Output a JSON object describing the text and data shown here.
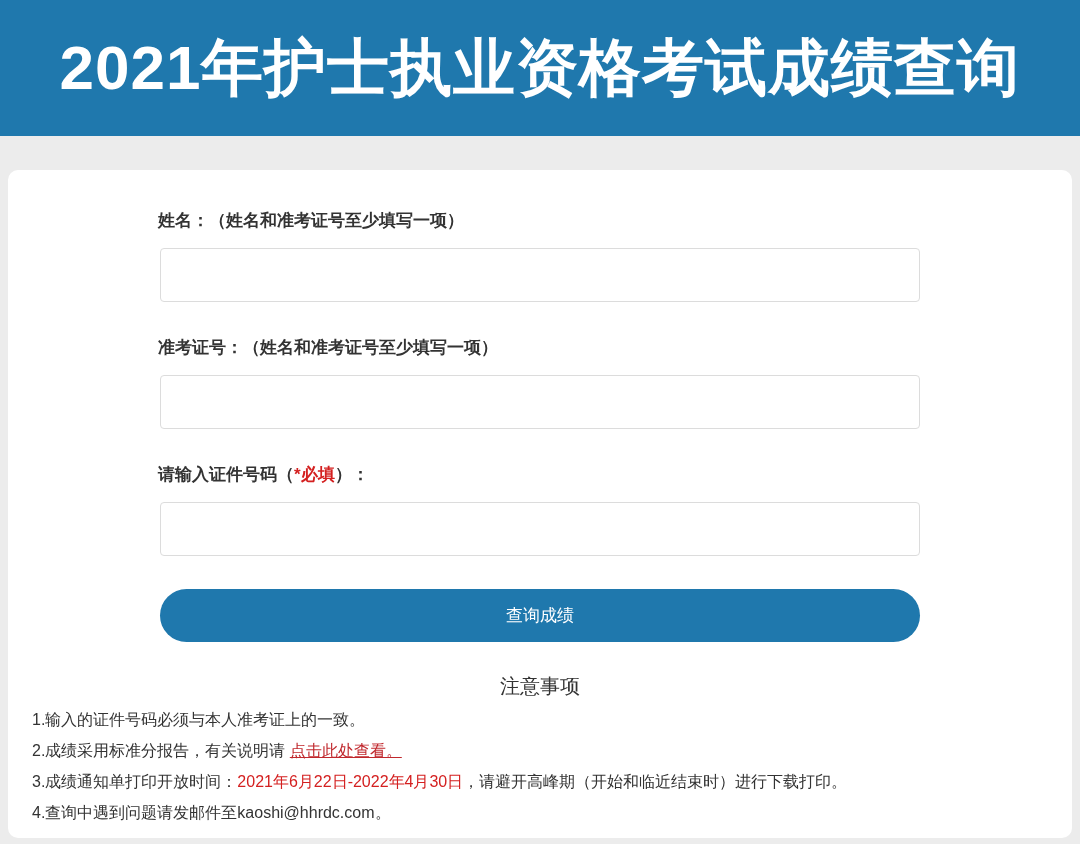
{
  "header": {
    "title": "2021年护士执业资格考试成绩查询"
  },
  "form": {
    "fields": [
      {
        "label": [
          {
            "kind": "text",
            "text": "姓名：（姓名和准考证号至少填写一项）"
          }
        ]
      },
      {
        "label": [
          {
            "kind": "text",
            "text": "准考证号：（姓名和准考证号至少填写一项）"
          }
        ]
      },
      {
        "label": [
          {
            "kind": "text",
            "text": "请输入证件号码（"
          },
          {
            "kind": "required",
            "text": "*必填"
          },
          {
            "kind": "text",
            "text": "）："
          }
        ]
      }
    ],
    "submit": "查询成绩"
  },
  "notes": {
    "title": "注意事项",
    "items": [
      [
        {
          "kind": "text",
          "text": "1.输入的证件号码必须与本人准考证上的一致。"
        }
      ],
      [
        {
          "kind": "text",
          "text": "2.成绩采用标准分报告，有关说明请 "
        },
        {
          "kind": "link",
          "text": "点击此处查看。"
        }
      ],
      [
        {
          "kind": "text",
          "text": "3.成绩通知单打印开放时间："
        },
        {
          "kind": "highlight",
          "text": "2021年6月22日-2022年4月30日"
        },
        {
          "kind": "text",
          "text": "，请避开高峰期（开始和临近结束时）进行下载打印。"
        }
      ],
      [
        {
          "kind": "text",
          "text": "4.查询中遇到问题请发邮件至kaoshi@hhrdc.com。"
        }
      ]
    ]
  }
}
